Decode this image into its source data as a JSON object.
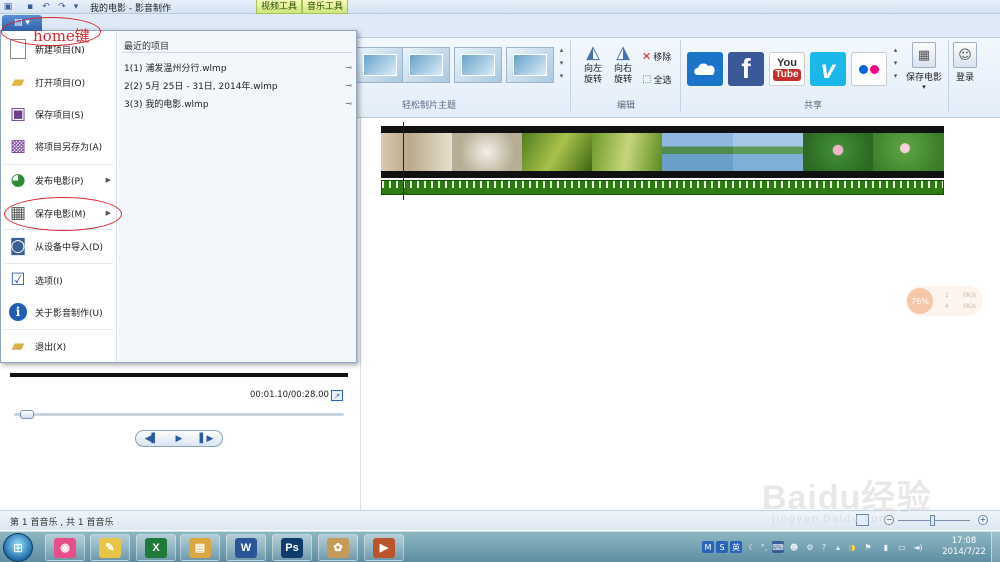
{
  "window": {
    "title": "我的电影 - 影音制作",
    "context_tabs": [
      "视频工具",
      "音乐工具"
    ]
  },
  "annotations": {
    "home_label": "home键"
  },
  "app_menu": {
    "items": [
      {
        "label": "新建项目(N)",
        "icon": "new-project-icon"
      },
      {
        "label": "打开项目(O)",
        "icon": "open-project-icon"
      },
      {
        "label": "保存项目(S)",
        "icon": "save-project-icon"
      },
      {
        "label": "将项目另存为(A)",
        "icon": "save-as-icon"
      },
      {
        "label": "发布电影(P)",
        "icon": "publish-movie-icon"
      },
      {
        "label": "保存电影(M)",
        "icon": "save-movie-icon"
      },
      {
        "label": "从设备中导入(D)",
        "icon": "import-device-icon"
      },
      {
        "label": "选项(I)",
        "icon": "options-icon"
      },
      {
        "label": "关于影音制作(U)",
        "icon": "about-icon"
      },
      {
        "label": "退出(X)",
        "icon": "exit-icon"
      }
    ],
    "recent_header": "最近的项目",
    "recent_items": [
      "1(1)  浦发温州分行.wlmp",
      "2(2)  5月 25日 - 31日, 2014年.wlmp",
      "3(3)  我的电影.wlmp"
    ]
  },
  "ribbon": {
    "groups": {
      "themes": "轻松制片主题",
      "edit": "编辑",
      "share": "共享"
    },
    "rotate_left": [
      "向左",
      "旋转"
    ],
    "rotate_right": [
      "向右",
      "旋转"
    ],
    "remove_label": "移除",
    "select_all_label": "全选",
    "save_movie_label": "保存电影",
    "login_label": "登录",
    "share_services": [
      {
        "name": "skydrive-icon",
        "color": "#1b74c9"
      },
      {
        "name": "facebook-icon",
        "color": "#3b5998",
        "text": "f"
      },
      {
        "name": "youtube-icon",
        "color": "#c4302b",
        "text": "You\nTube"
      },
      {
        "name": "vimeo-icon",
        "color": "#1ab7ea",
        "text": "v"
      },
      {
        "name": "flickr-icon",
        "color": "#ffffff"
      }
    ]
  },
  "preview": {
    "time_readout": "00:01.10/00:28.00",
    "seek_fraction": 0.04
  },
  "net_widget": {
    "percent": "76%",
    "up": "0K/s",
    "down": "0K/s",
    "up_count": "1",
    "down_count": "4"
  },
  "status": {
    "text": "第 1 首音乐 , 共 1 首音乐"
  },
  "watermark": {
    "brand": "Baidu经验",
    "url": "jingyan.baidu.com"
  },
  "taskbar": {
    "apps": [
      {
        "name": "picasa-icon",
        "color": "#e84e8a",
        "glyph": "◉"
      },
      {
        "name": "notes-icon",
        "color": "#e6c547",
        "glyph": "✎"
      },
      {
        "name": "excel-icon",
        "color": "#1f7a3a",
        "glyph": "X"
      },
      {
        "name": "explorer-icon",
        "color": "#d9a640",
        "glyph": "▤"
      },
      {
        "name": "word-icon",
        "color": "#2a5699",
        "glyph": "W"
      },
      {
        "name": "photoshop-icon",
        "color": "#0f3b6d",
        "glyph": "Ps"
      },
      {
        "name": "paint-icon",
        "color": "#c69b5a",
        "glyph": "✿"
      },
      {
        "name": "movie-maker-icon",
        "color": "#b8552a",
        "glyph": "▶"
      }
    ],
    "clock_time": "17:08",
    "clock_date": "2014/7/22",
    "ime_label": "英"
  }
}
